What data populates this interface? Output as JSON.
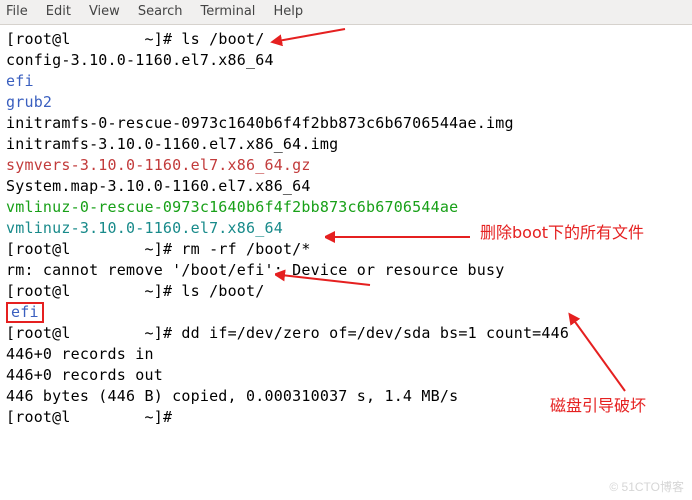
{
  "menu": {
    "file": "File",
    "edit": "Edit",
    "view": "View",
    "search": "Search",
    "terminal": "Terminal",
    "help": "Help"
  },
  "prompt_prefix": "[root@l",
  "prompt_mask": "       ",
  "prompt_suffix": " ~]#",
  "cmd_ls": " ls /boot/",
  "ls_out": {
    "config": "config-3.10.0-1160.el7.x86_64",
    "efi": "efi",
    "grub2": "grub2",
    "initramfs_rescue": "initramfs-0-rescue-0973c1640b6f4f2bb873c6b6706544ae.img",
    "initramfs": "initramfs-3.10.0-1160.el7.x86_64.img",
    "symvers": "symvers-3.10.0-1160.el7.x86_64.gz",
    "sysmap": "System.map-3.10.0-1160.el7.x86_64",
    "vmlinuz_rescue": "vmlinuz-0-rescue-0973c1640b6f4f2bb873c6b6706544ae",
    "vmlinuz": "vmlinuz-3.10.0-1160.el7.x86_64"
  },
  "cmd_rm": " rm -rf /boot/*",
  "rm_err": "rm: cannot remove '/boot/efi': Device or resource busy",
  "ls2_efi": "efi",
  "cmd_dd": " dd if=/dev/zero of=/dev/sda bs=1 count=446",
  "dd_out1": "446+0 records in",
  "dd_out2": "446+0 records out",
  "dd_out3": "446 bytes (446 B) copied, 0.000310037 s, 1.4 MB/s",
  "annotations": {
    "delete_all": "删除boot下的所有文件",
    "disk_broken": "磁盘引导破坏"
  },
  "watermark": "© 51CTO博客"
}
